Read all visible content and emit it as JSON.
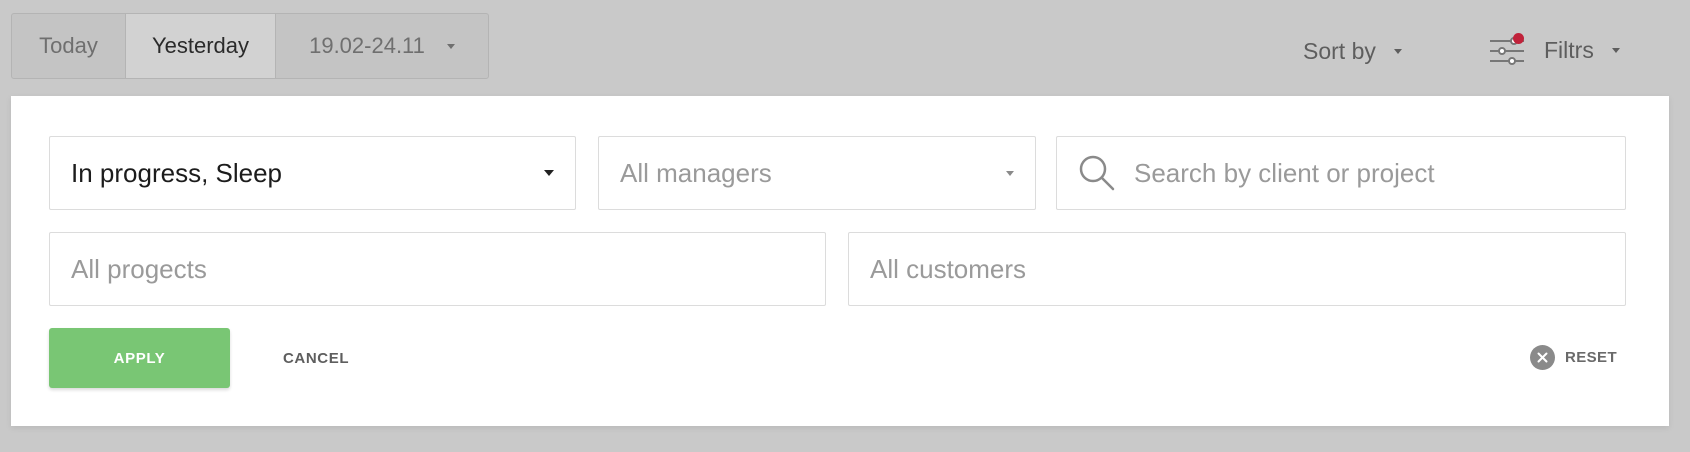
{
  "date_tabs": {
    "today": "Today",
    "yesterday": "Yesterday",
    "range": "19.02-24.11",
    "selected": "Yesterday"
  },
  "sort": {
    "label": "Sort by"
  },
  "filters": {
    "label": "Filtrs",
    "indicator_color": "#c0223a"
  },
  "panel": {
    "status_select": {
      "value": "In progress, Sleep"
    },
    "managers_select": {
      "value": "All managers"
    },
    "search": {
      "placeholder": "Search by client or project",
      "value": ""
    },
    "projects_select": {
      "value": "All progects"
    },
    "customers_select": {
      "value": "All customers"
    },
    "apply_label": "APPLY",
    "cancel_label": "CANCEL",
    "reset_label": "RESET",
    "apply_color": "#79c674"
  },
  "icons": [
    "chevron-down-icon",
    "filter-sliders-icon",
    "search-icon",
    "clear-icon"
  ]
}
